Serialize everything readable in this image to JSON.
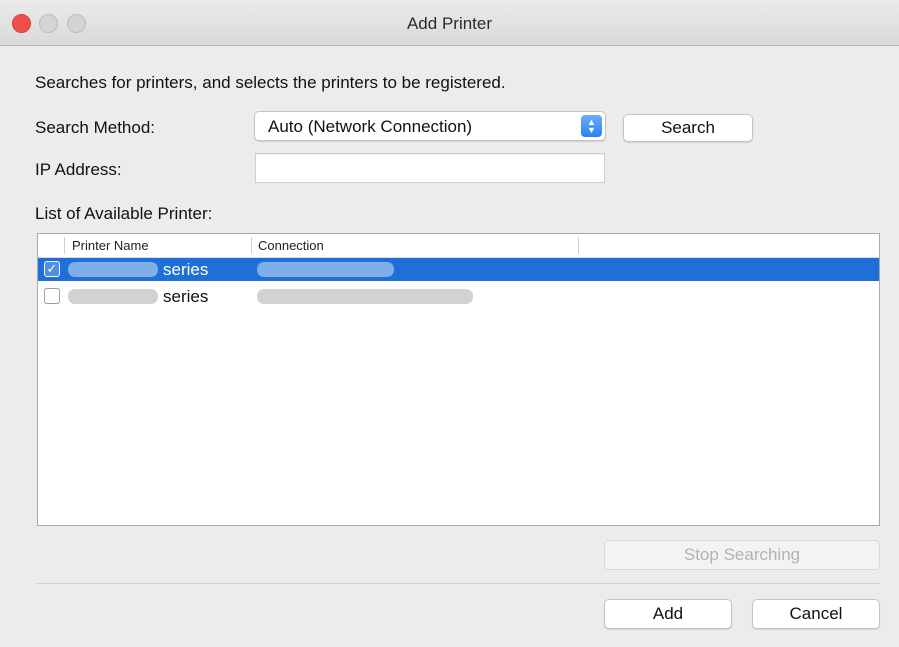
{
  "window": {
    "title": "Add Printer"
  },
  "intro_text": "Searches for printers, and selects the printers to be registered.",
  "search_method": {
    "label": "Search Method:",
    "value": "Auto (Network Connection)",
    "button": "Search"
  },
  "ip_address": {
    "label": "IP Address:",
    "value": ""
  },
  "printer_list": {
    "label": "List of Available Printer:",
    "columns": [
      "Printer Name",
      "Connection"
    ],
    "rows": [
      {
        "checked": true,
        "selected": true,
        "name_suffix": "series"
      },
      {
        "checked": false,
        "selected": false,
        "name_suffix": "series"
      }
    ]
  },
  "buttons": {
    "stop": "Stop Searching",
    "add": "Add",
    "cancel": "Cancel"
  },
  "icons": {
    "checkmark": "✓",
    "stepper_up": "▲",
    "stepper_down": "▼"
  },
  "colors": {
    "selection": "#1f6fd8",
    "close": "#f0504a",
    "accent": "#2a7ff3"
  }
}
